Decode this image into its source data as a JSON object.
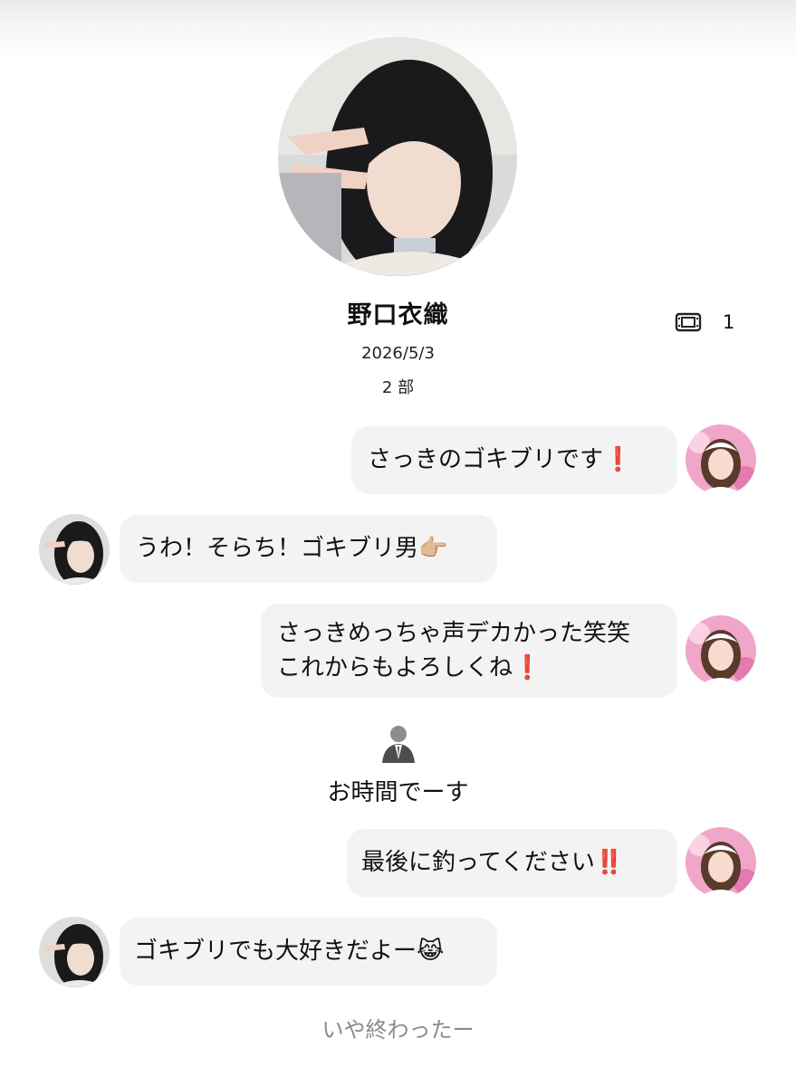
{
  "profile": {
    "name": "野口衣織",
    "date": "2026/5/3",
    "part": "2 部",
    "ticket_count": "1",
    "ticket_icon": "film-ticket-icon"
  },
  "messages": [
    {
      "side": "right",
      "text": "さっきのゴキブリです",
      "suffix": "❗"
    },
    {
      "side": "left",
      "text": "うわ！そらち！ゴキブリ男",
      "suffix": "👉🏼"
    },
    {
      "side": "right",
      "lines": [
        "さっきめっちゃ声デカかった笑笑",
        "これからもよろしくね"
      ],
      "suffix": "❗"
    },
    {
      "side": "right",
      "text": "最後に釣ってください",
      "suffix": "‼️"
    },
    {
      "side": "left",
      "text": "ゴキブリでも大好きだよー",
      "suffix": "😹"
    }
  ],
  "system": {
    "icon": "staff-person-icon",
    "text": "お時間でーす"
  },
  "footer": {
    "text": "いや終わったー"
  },
  "colors": {
    "bubble": "#f3f3f3",
    "exclamation": "#e0241b",
    "footer_text": "#8a8a8a"
  }
}
